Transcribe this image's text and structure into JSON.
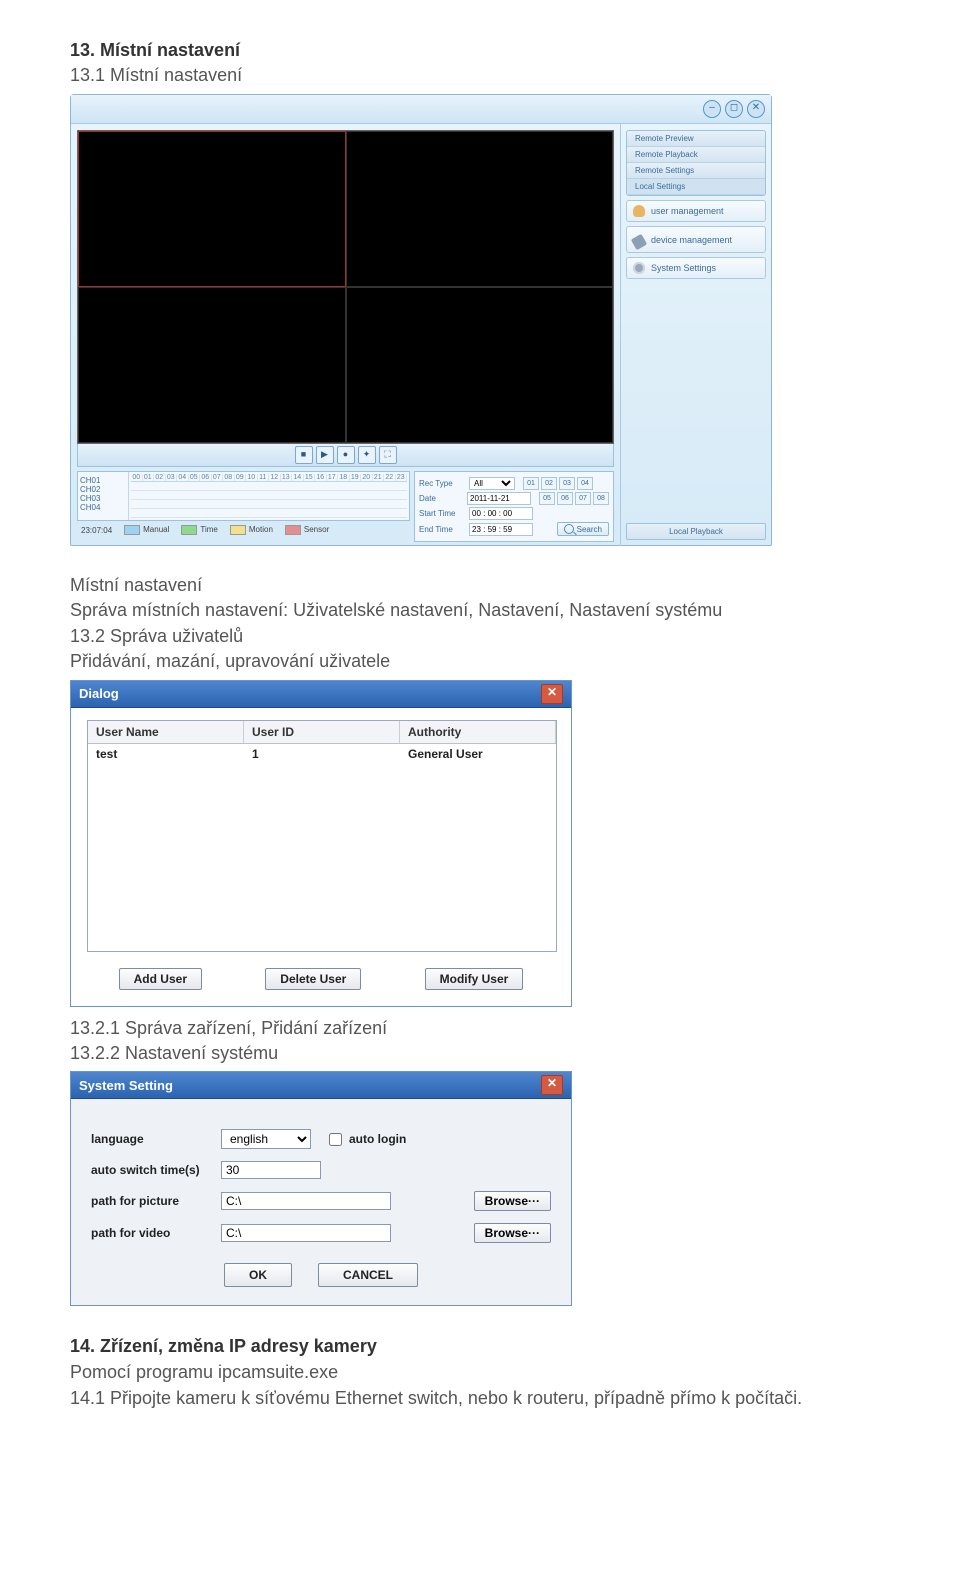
{
  "doc": {
    "h13": "13. Místní nastavení",
    "s131": "13.1 Místní nastavení",
    "mn_title": "Místní nastavení",
    "mn_desc": "Správa místních nastavení: Uživatelské nastavení, Nastavení, Nastavení systému",
    "s132": "13.2 Správa uživatelů",
    "s132_desc": "Přidávání, mazání, upravování uživatele",
    "s1321": "13.2.1 Správa zařízení, Přidání zařízení",
    "s1322": "13.2.2 Nastavení systému",
    "h14": "14. Zřízení, změna IP adresy kamery",
    "s14a": "Pomocí programu ipcamsuite.exe",
    "s141": "14.1 Připojte kameru k síťovému Ethernet switch, nebo k routeru, případně přímo k počítači."
  },
  "cms": {
    "side_tabs": [
      "Remote Preview",
      "Remote Playback",
      "Remote Settings",
      "Local Settings"
    ],
    "side_buttons": [
      {
        "label": "user management"
      },
      {
        "label": "device management"
      },
      {
        "label": "System Settings"
      }
    ],
    "local_playback": "Local Playback",
    "channels": [
      "CH01",
      "CH02",
      "CH03",
      "CH04"
    ],
    "hours": [
      "00",
      "01",
      "02",
      "03",
      "04",
      "05",
      "06",
      "07",
      "08",
      "09",
      "10",
      "11",
      "12",
      "13",
      "14",
      "15",
      "16",
      "17",
      "18",
      "19",
      "20",
      "21",
      "22",
      "23"
    ],
    "legend": {
      "time": "23:07:04",
      "manual": "Manual",
      "time_l": "Time",
      "motion": "Motion",
      "sensor": "Sensor"
    },
    "search_panel": {
      "rec_type_label": "Rec Type",
      "rec_type_value": "All",
      "date_label": "Date",
      "date_value": "2011-11-21",
      "start_label": "Start Time",
      "start_value": "00 : 00 : 00",
      "end_label": "End Time",
      "end_value": "23 : 59 : 59",
      "chips": [
        "01",
        "02",
        "03",
        "04",
        "05",
        "06",
        "07",
        "08"
      ],
      "search": "Search"
    }
  },
  "dialog": {
    "title": "Dialog",
    "col_user": "User Name",
    "col_id": "User ID",
    "col_auth": "Authority",
    "row": {
      "name": "test",
      "id": "1",
      "auth": "General User"
    },
    "add": "Add User",
    "del": "Delete User",
    "mod": "Modify User"
  },
  "sysset": {
    "title": "System Setting",
    "lang_label": "language",
    "lang_value": "english",
    "auto_login": "auto login",
    "switch_label": "auto switch time(s)",
    "switch_value": "30",
    "pic_label": "path for picture",
    "pic_value": "C:\\",
    "vid_label": "path for video",
    "vid_value": "C:\\",
    "browse": "Browse···",
    "ok": "OK",
    "cancel": "CANCEL"
  }
}
